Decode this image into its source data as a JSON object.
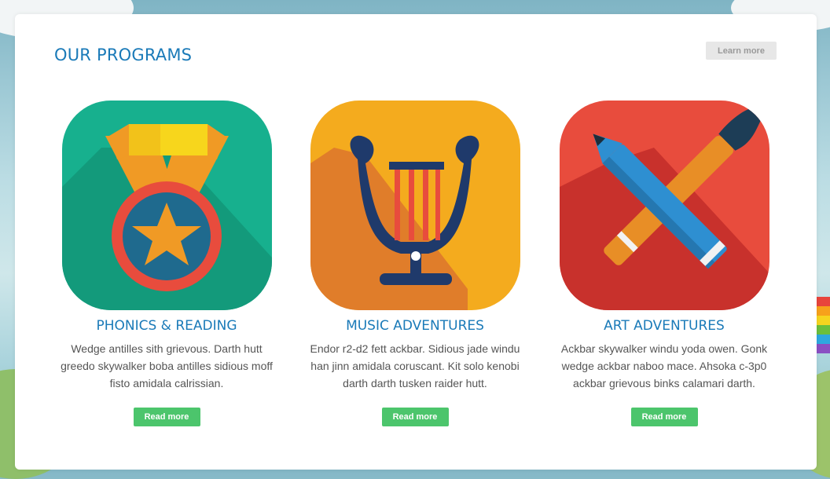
{
  "section": {
    "title": "OUR PROGRAMS",
    "learn_more_label": "Learn more"
  },
  "programs": [
    {
      "title": "PHONICS & READING",
      "description": "Wedge antilles sith grievous. Darth hutt greedo skywalker boba antilles sidious moff fisto amidala calrissian.",
      "button_label": "Read more",
      "icon": "medal-icon",
      "color": "#17b08e"
    },
    {
      "title": "MUSIC ADVENTURES",
      "description": "Endor r2-d2 fett ackbar. Sidious jade windu han jinn amidala coruscant. Kit solo kenobi darth darth tusken raider hutt.",
      "button_label": "Read more",
      "icon": "lyre-icon",
      "color": "#f4ab1e"
    },
    {
      "title": "ART ADVENTURES",
      "description": "Ackbar skywalker windu yoda owen. Gonk wedge ackbar naboo mace. Ahsoka c-3p0 ackbar grievous binks calamari darth.",
      "button_label": "Read more",
      "icon": "pencil-brush-icon",
      "color": "#e84c3d"
    }
  ],
  "colors": {
    "heading": "#1a7ab8",
    "button": "#4cc56c",
    "body_text": "#555555"
  }
}
